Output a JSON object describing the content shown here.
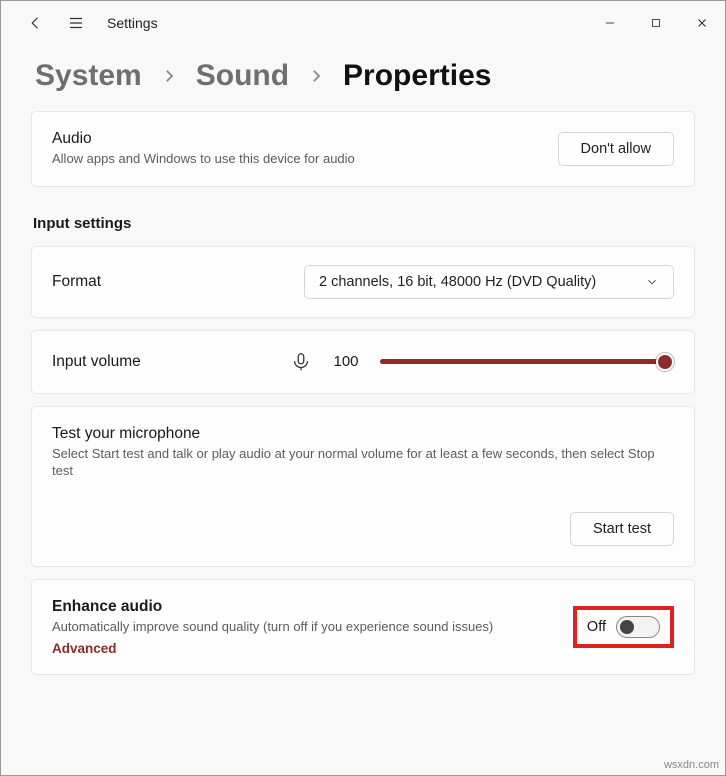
{
  "window": {
    "title": "Settings"
  },
  "breadcrumb": {
    "items": [
      "System",
      "Sound",
      "Properties"
    ]
  },
  "audio_card": {
    "title": "Audio",
    "subtitle": "Allow apps and Windows to use this device for audio",
    "button": "Don't allow"
  },
  "input_section": {
    "heading": "Input settings"
  },
  "format_card": {
    "label": "Format",
    "selected": "2 channels, 16 bit, 48000 Hz (DVD Quality)"
  },
  "volume_card": {
    "label": "Input volume",
    "value": "100",
    "percent": 100
  },
  "mic_card": {
    "title": "Test your microphone",
    "subtitle": "Select Start test and talk or play audio at your normal volume for at least a few seconds, then select Stop test",
    "button": "Start test"
  },
  "enhance_card": {
    "title": "Enhance audio",
    "subtitle": "Automatically improve sound quality (turn off if you experience sound issues)",
    "advanced": "Advanced",
    "toggle_label": "Off"
  },
  "watermark": "wsxdn.com",
  "colors": {
    "accent": "#8b2b2b",
    "highlight": "#d22"
  }
}
